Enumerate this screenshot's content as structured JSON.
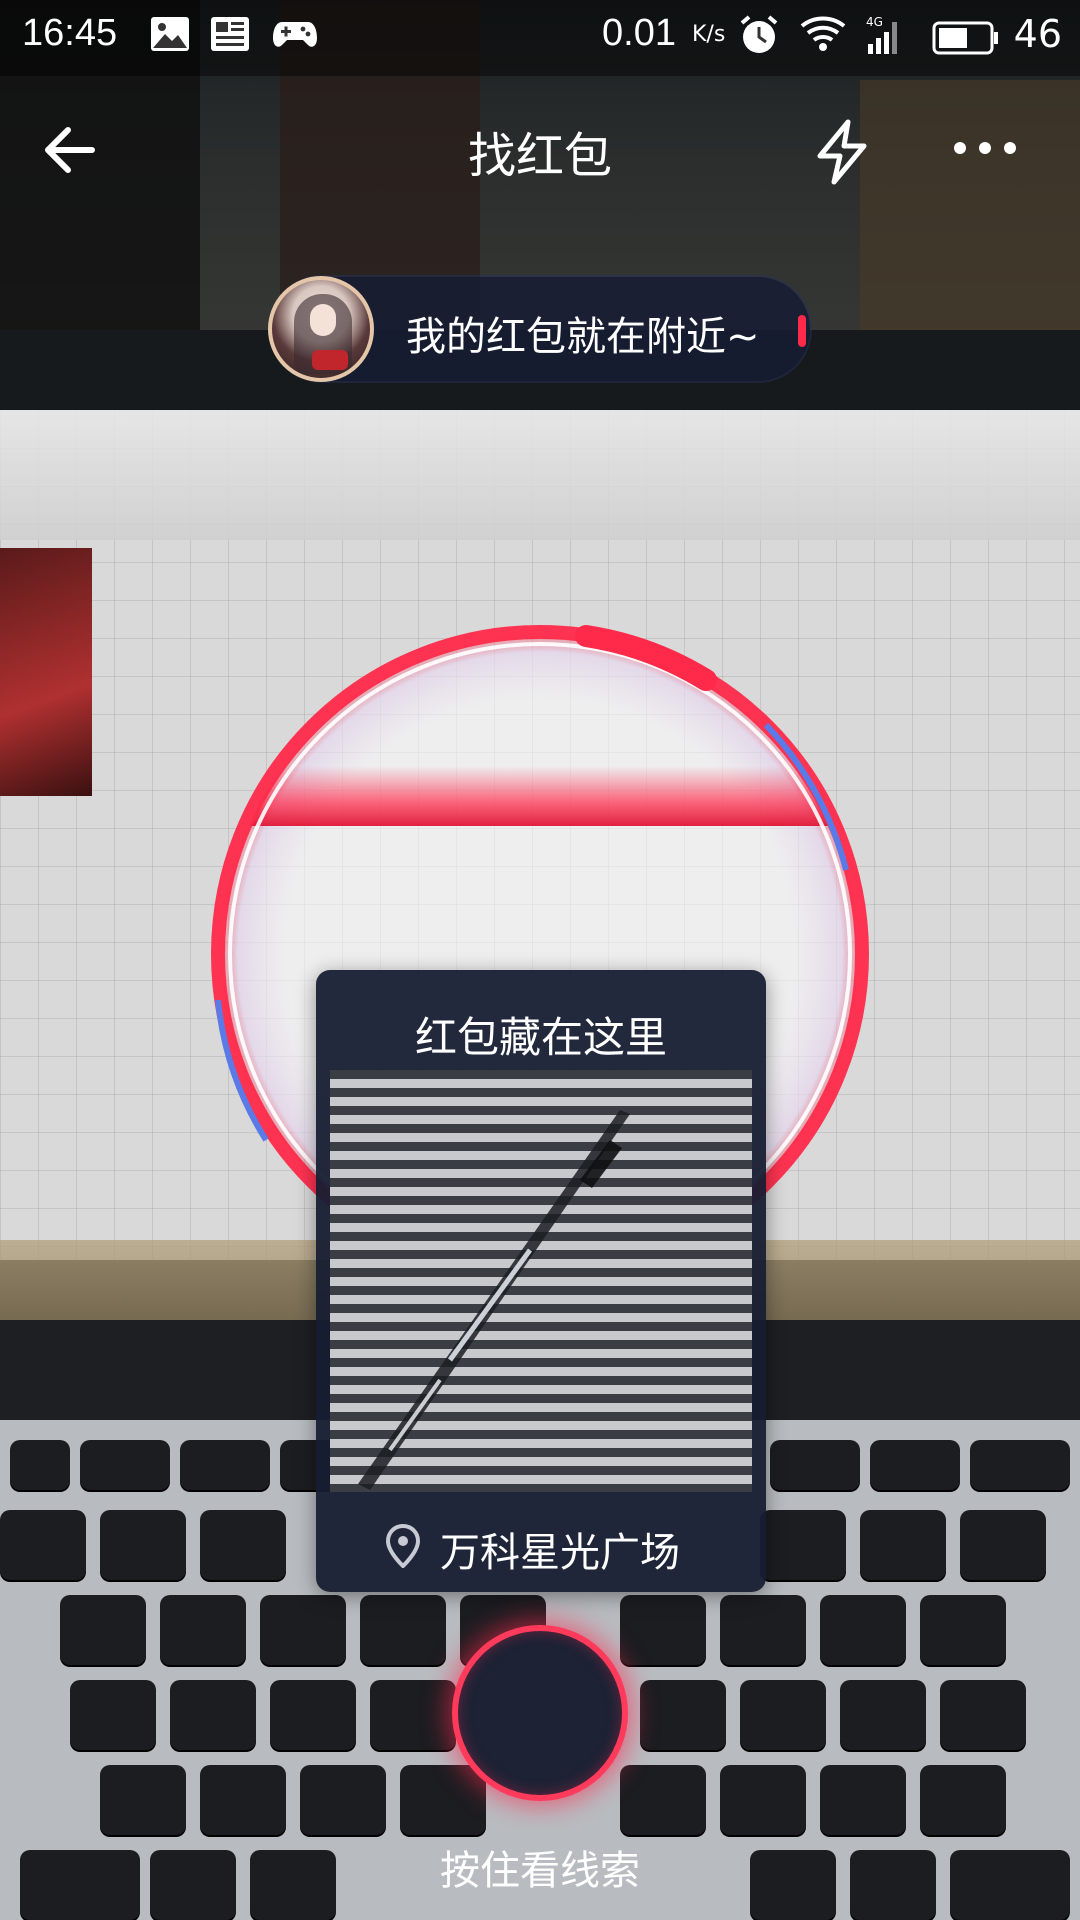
{
  "status_bar": {
    "time": "16:45",
    "speed_value": "0.01",
    "speed_unit": "K/s",
    "battery_level": "46",
    "icons": [
      "image-icon",
      "news-icon",
      "gamepad-icon",
      "alarm-icon",
      "wifi-icon",
      "signal-4g-icon",
      "battery-icon"
    ]
  },
  "nav": {
    "title": "找红包",
    "back_icon": "back-arrow-icon",
    "flash_icon": "flash-icon",
    "more_icon": "more-dots-icon"
  },
  "hint": {
    "message": "我的红包就在附近~"
  },
  "clue_card": {
    "title": "红包藏在这里",
    "location": "万科星光广场",
    "location_icon": "location-pin-icon"
  },
  "action": {
    "hold_label": "按住看线索"
  },
  "colors": {
    "accent_red": "#ff2a4a",
    "panel_navy": "#171d33",
    "ring_blue": "#5a7ae8"
  }
}
